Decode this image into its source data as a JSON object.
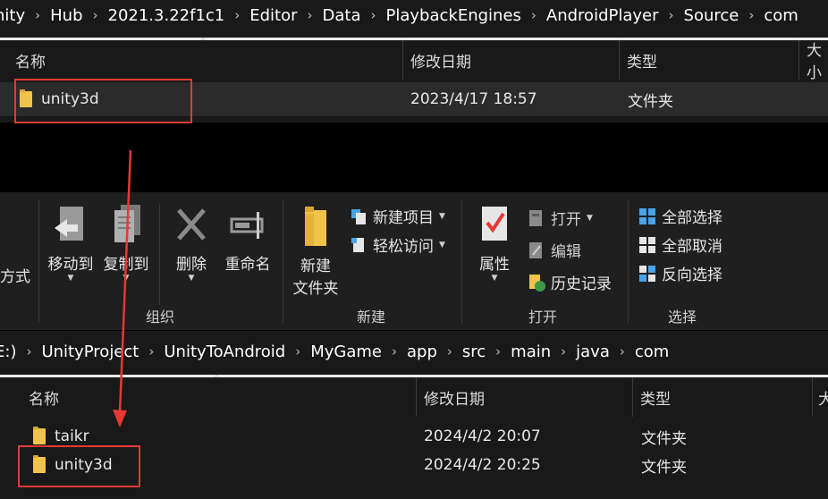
{
  "top_explorer": {
    "breadcrumb": [
      "nity",
      "Hub",
      "2021.3.22f1c1",
      "Editor",
      "Data",
      "PlaybackEngines",
      "AndroidPlayer",
      "Source",
      "com"
    ],
    "columns": {
      "name": "名称",
      "date": "修改日期",
      "type": "类型",
      "size": "大小"
    },
    "rows": [
      {
        "name": "unity3d",
        "date": "2023/4/17 18:57",
        "type": "文件夹"
      }
    ]
  },
  "ribbon": {
    "edge_label": "方式",
    "groups": {
      "organize": {
        "label": "组织",
        "move_to": "移动到",
        "copy_to": "复制到",
        "delete": "删除",
        "rename": "重命名"
      },
      "new": {
        "label": "新建",
        "new_item": "新建项目",
        "easy_access": "轻松访问",
        "new_folder_line1": "新建",
        "new_folder_line2": "文件夹"
      },
      "open": {
        "label": "打开",
        "properties": "属性",
        "open": "打开",
        "edit": "编辑",
        "history": "历史记录"
      },
      "select": {
        "label": "选择",
        "select_all": "全部选择",
        "select_none": "全部取消",
        "invert": "反向选择"
      }
    }
  },
  "bottom_explorer": {
    "breadcrumb": [
      "E:)",
      "UnityProject",
      "UnityToAndroid",
      "MyGame",
      "app",
      "src",
      "main",
      "java",
      "com"
    ],
    "columns": {
      "name": "名称",
      "date": "修改日期",
      "type": "类型",
      "size": "大"
    },
    "rows": [
      {
        "name": "taikr",
        "date": "2024/4/2 20:07",
        "type": "文件夹"
      },
      {
        "name": "unity3d",
        "date": "2024/4/2 20:25",
        "type": "文件夹"
      }
    ]
  },
  "colors": {
    "annotation_red": "#e53935",
    "folder_yellow": "#f2c34a",
    "panel_bg": "#191919",
    "ribbon_bg": "#1f1f1f"
  }
}
